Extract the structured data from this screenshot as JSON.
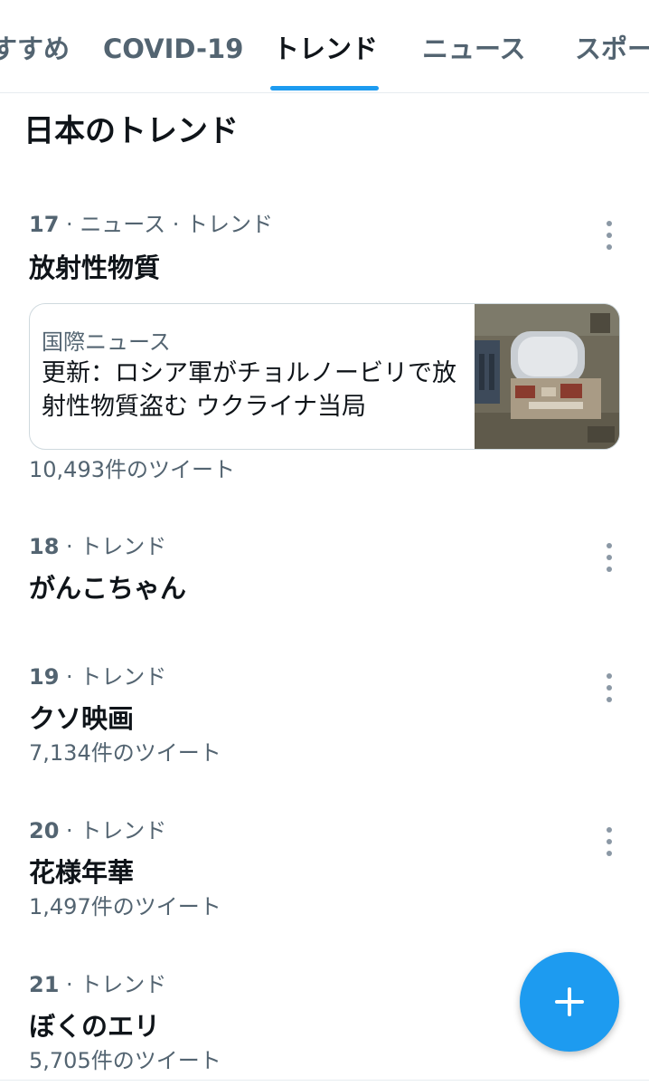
{
  "tabs": [
    {
      "label": "すすめ",
      "active": false
    },
    {
      "label": "COVID-19",
      "active": false
    },
    {
      "label": "トレンド",
      "active": true
    },
    {
      "label": "ニュース",
      "active": false
    },
    {
      "label": "スポー",
      "active": false
    }
  ],
  "section_title": "日本のトレンド",
  "trends": [
    {
      "rank": "17",
      "category": "ニュース · トレンド",
      "name": "放射性物質",
      "tweet_count": "10,493件のツイート",
      "news": {
        "source": "国際ニュース",
        "headline": "更新：ロシア軍がチョルノービリで放射性物質盗む ウクライナ当局"
      }
    },
    {
      "rank": "18",
      "category": "トレンド",
      "name": "がんこちゃん"
    },
    {
      "rank": "19",
      "category": "トレンド",
      "name": "クソ映画",
      "tweet_count": "7,134件のツイート"
    },
    {
      "rank": "20",
      "category": "トレンド",
      "name": "花様年華",
      "tweet_count": "1,497件のツイート"
    },
    {
      "rank": "21",
      "category": "トレンド",
      "name": "ぼくのエリ",
      "tweet_count": "5,705件のツイート"
    }
  ],
  "colors": {
    "accent": "#1d9bf0",
    "text_primary": "#0f1419",
    "text_secondary": "#536471"
  },
  "icons": {
    "more": "more-vertical-icon",
    "compose": "plus-icon"
  }
}
